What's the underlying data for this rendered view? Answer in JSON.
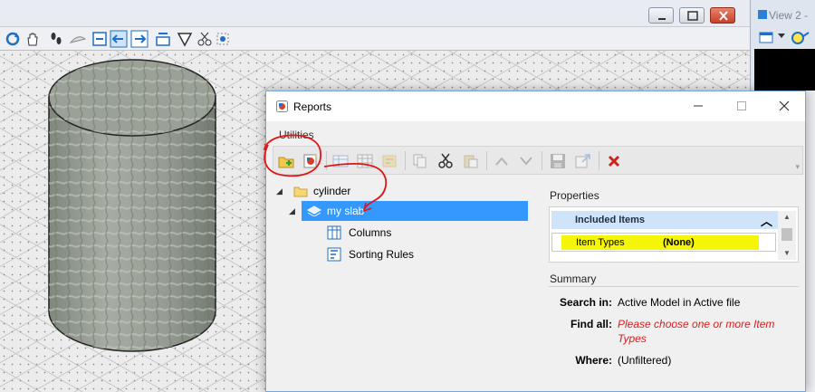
{
  "side_panel": {
    "title": "View 2 -"
  },
  "dialog": {
    "title": "Reports",
    "menu": {
      "utilities": "Utilities"
    },
    "tree": {
      "items": [
        {
          "label": "cylinder"
        },
        {
          "label": "my slab"
        },
        {
          "label": "Columns"
        },
        {
          "label": "Sorting Rules"
        }
      ]
    },
    "properties": {
      "label": "Properties",
      "group_header": "Included Items",
      "row": {
        "key": "Item Types",
        "value": "(None)"
      }
    },
    "summary": {
      "label": "Summary",
      "search_in_label": "Search in:",
      "search_in_value": "Active Model  in Active file",
      "find_all_label": "Find all:",
      "find_all_value": "Please choose one or more Item Types",
      "where_label": "Where:",
      "where_value": "(Unfiltered)"
    }
  },
  "colors": {
    "selection": "#3399ff",
    "highlight": "#f5f50a",
    "error_text": "#d32020",
    "annotation": "#e01515"
  }
}
